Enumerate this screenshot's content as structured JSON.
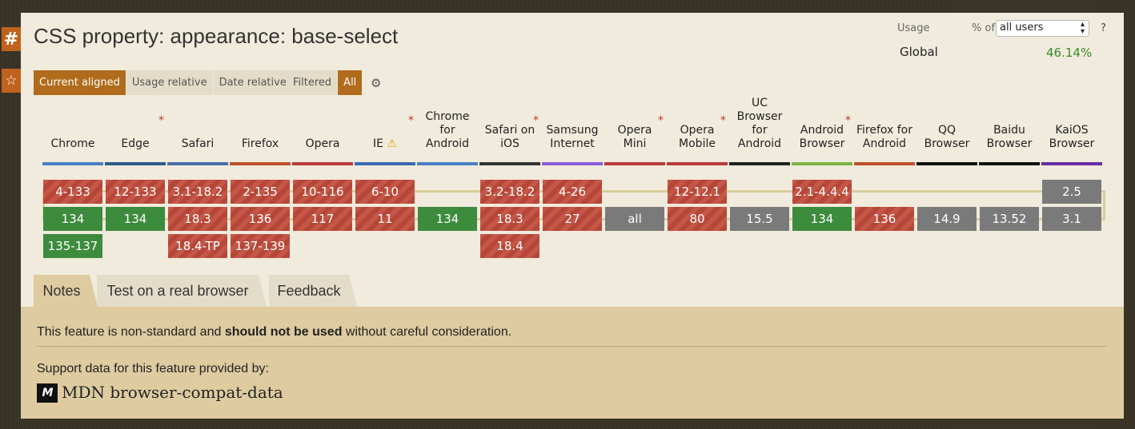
{
  "side": {
    "hash_icon": "#",
    "star_icon": "☆"
  },
  "title": "CSS property: appearance: base-select",
  "usage": {
    "label": "Usage",
    "pct_of": "% of",
    "select_value": "all users",
    "help": "?",
    "region": "Global",
    "value": "46.14%"
  },
  "view_buttons": [
    "Current aligned",
    "Usage relative",
    "Date relative"
  ],
  "filter_buttons": [
    "Filtered",
    "All"
  ],
  "browsers": [
    {
      "name": "Chrome",
      "star": false,
      "warn": false,
      "bar": "#4a7ec4",
      "rows": [
        [
          "4-133",
          "n"
        ],
        [
          "134",
          "y"
        ],
        [
          "135-137",
          "y"
        ]
      ]
    },
    {
      "name": "Edge",
      "star": true,
      "warn": false,
      "bar": "#2e5b8c",
      "rows": [
        [
          "12-133",
          "n"
        ],
        [
          "134",
          "y"
        ],
        null
      ]
    },
    {
      "name": "Safari",
      "star": false,
      "warn": false,
      "bar": "#4a6ea8",
      "rows": [
        [
          "3.1-18.2",
          "n"
        ],
        [
          "18.3",
          "n"
        ],
        [
          "18.4-TP",
          "n"
        ]
      ]
    },
    {
      "name": "Firefox",
      "star": false,
      "warn": false,
      "bar": "#c0502c",
      "rows": [
        [
          "2-135",
          "n"
        ],
        [
          "136",
          "n"
        ],
        [
          "137-139",
          "n"
        ]
      ]
    },
    {
      "name": "Opera",
      "star": false,
      "warn": false,
      "bar": "#b83a3a",
      "rows": [
        [
          "10-116",
          "n"
        ],
        [
          "117",
          "n"
        ],
        null
      ]
    },
    {
      "name": "IE",
      "star": true,
      "warn": true,
      "bar": "#3a6ab0",
      "rows": [
        [
          "6-10",
          "n"
        ],
        [
          "11",
          "n"
        ],
        null
      ]
    },
    {
      "name": "Chrome for Android",
      "star": false,
      "warn": false,
      "bar": "#4a7ec4",
      "rows": [
        null,
        [
          "134",
          "y"
        ],
        null
      ]
    },
    {
      "name": "Safari on iOS",
      "star": true,
      "warn": false,
      "bar": "#333333",
      "rows": [
        [
          "3.2-18.2",
          "n"
        ],
        [
          "18.3",
          "n"
        ],
        [
          "18.4",
          "n"
        ]
      ]
    },
    {
      "name": "Samsung Internet",
      "star": false,
      "warn": false,
      "bar": "#8a5cd6",
      "rows": [
        [
          "4-26",
          "n"
        ],
        [
          "27",
          "n"
        ],
        null
      ]
    },
    {
      "name": "Opera Mini",
      "star": true,
      "warn": false,
      "bar": "#b83a3a",
      "rows": [
        null,
        [
          "all",
          "u"
        ],
        null
      ]
    },
    {
      "name": "Opera Mobile",
      "star": true,
      "warn": false,
      "bar": "#b83a3a",
      "rows": [
        [
          "12-12.1",
          "n"
        ],
        [
          "80",
          "n"
        ],
        null
      ]
    },
    {
      "name": "UC Browser for Android",
      "star": false,
      "warn": false,
      "bar": "#222222",
      "rows": [
        null,
        [
          "15.5",
          "u"
        ],
        null
      ]
    },
    {
      "name": "Android Browser",
      "star": true,
      "warn": false,
      "bar": "#7cb342",
      "rows": [
        [
          "2.1-4.4.4",
          "n"
        ],
        [
          "134",
          "y"
        ],
        null
      ]
    },
    {
      "name": "Firefox for Android",
      "star": false,
      "warn": false,
      "bar": "#c0502c",
      "rows": [
        null,
        [
          "136",
          "n"
        ],
        null
      ]
    },
    {
      "name": "QQ Browser",
      "star": false,
      "warn": false,
      "bar": "#111111",
      "rows": [
        null,
        [
          "14.9",
          "u"
        ],
        null
      ]
    },
    {
      "name": "Baidu Browser",
      "star": false,
      "warn": false,
      "bar": "#111111",
      "rows": [
        null,
        [
          "13.52",
          "u"
        ],
        null
      ]
    },
    {
      "name": "KaiOS Browser",
      "star": false,
      "warn": false,
      "bar": "#6a2ca8",
      "rows": [
        [
          "2.5",
          "u"
        ],
        [
          "3.1",
          "u"
        ],
        null
      ]
    }
  ],
  "colors": {
    "no": "#c04a3a",
    "yes": "#3d8b3d",
    "unknown": "#7a7a7a",
    "accent": "#b06c1c"
  },
  "tabs": [
    "Notes",
    "Test on a real browser",
    "Feedback"
  ],
  "notes": {
    "pre": "This feature is non-standard and ",
    "bold": "should not be used",
    "post": " without careful consideration.",
    "support": "Support data for this feature provided by:",
    "mdn_logo": "M",
    "mdn_name": "MDN browser-compat-data"
  }
}
